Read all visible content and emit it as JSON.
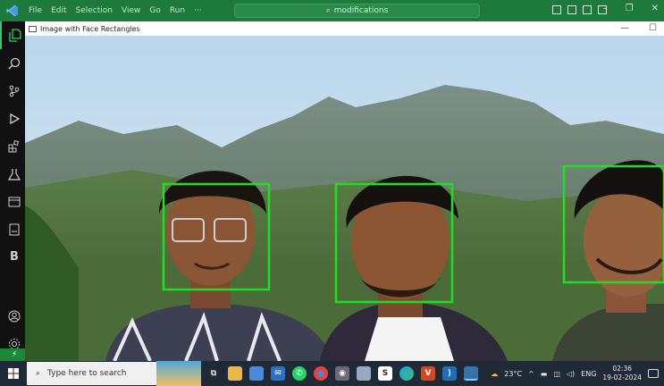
{
  "vscode": {
    "menu": [
      "File",
      "Edit",
      "Selection",
      "View",
      "Go",
      "Run",
      "···"
    ],
    "nav_back": "←",
    "nav_forward": "→",
    "search_text": "modifications",
    "remote_label": "⚡"
  },
  "activity": {
    "items": [
      "explorer-icon",
      "search-icon",
      "source-control-icon",
      "run-debug-icon",
      "extensions-icon",
      "testing-icon",
      "remote-explorer-icon",
      "notebook-icon",
      "bookmark-icon"
    ],
    "bookmark_letter": "B"
  },
  "image_window": {
    "title": "Image with Face Rectangles",
    "minimize": "—",
    "maximize": "☐",
    "face_box_color": "#22dd22",
    "faces_detected": 3
  },
  "taskbar": {
    "search_placeholder": "Type here to search",
    "weather": "23°C",
    "language": "ENG",
    "time": "02:36",
    "date": "19-02-2024"
  }
}
